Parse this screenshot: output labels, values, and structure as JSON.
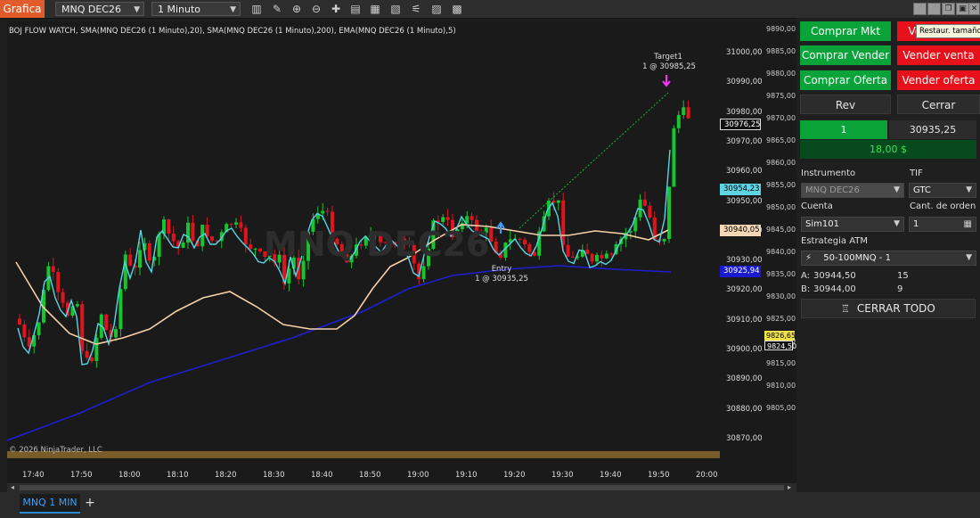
{
  "app_tab": "Grafica",
  "toolbar": {
    "instrument": "MNQ DEC26",
    "interval": "1 Minuto",
    "icons": [
      "bar-chart-icon",
      "pencil-icon",
      "zoom-in-icon",
      "zoom-out-icon",
      "crosshair-icon",
      "properties-icon",
      "indicators-icon",
      "strategies-icon",
      "alert-icon",
      "templates-icon"
    ]
  },
  "window_buttons": [
    "minimize-icon",
    "restore-icon",
    "maximize-icon",
    "close-icon"
  ],
  "tooltip": "Restaur. tamaño",
  "chart": {
    "indicators_label": "BOJ FLOW WATCH, SMA(MNQ DEC26 (1 Minuto),20), SMA(MNQ DEC26 (1 Minuto),200), EMA(MNQ DEC26 (1 Minuto),5)",
    "watermark": "MNQ DEC26",
    "copyright": "© 2026 NinjaTrader, LLC",
    "target_label": "Target1",
    "target_qty": "1 @ 30985,25",
    "entry_label": "Entry",
    "entry_qty": "1 @ 30935,25",
    "price_labels": [
      "31000,00",
      "30990,00",
      "30980,00",
      "30970,00",
      "30960,00",
      "30950,00",
      "30940,00",
      "30930,00",
      "30920,00",
      "30910,00",
      "30900,00",
      "30890,00",
      "30880,00",
      "30870,00"
    ],
    "price_labels2": [
      "9890,00",
      "9885,00",
      "9880,00",
      "9875,00",
      "9870,00",
      "9865,00",
      "9860,00",
      "9855,00",
      "9850,00",
      "9845,00",
      "9840,00",
      "9835,00",
      "9830,00",
      "9825,00",
      "9820,00",
      "9815,00",
      "9810,00",
      "9805,00"
    ],
    "price_boxes": {
      "last": "30976,25",
      "sma20": "30954,23",
      "ema": "30940,05",
      "sma200": "30925,94",
      "second1": "9826,65",
      "second2": "9824,50"
    },
    "time_labels": [
      "17:40",
      "17:50",
      "18:00",
      "18:10",
      "18:20",
      "18:30",
      "18:40",
      "18:50",
      "19:00",
      "19:10",
      "19:20",
      "19:30",
      "19:40",
      "19:50",
      "20:00"
    ]
  },
  "bottom_tab": "MNQ 1 MIN",
  "bottom_add": "+",
  "panel": {
    "buy_mkt": "Comprar Mkt",
    "sell_mkt": "Vender Mkt",
    "buy_bid": "Comprar Vender",
    "sell_ask": "Vender venta",
    "buy_offer": "Comprar Oferta",
    "sell_offer": "Vender oferta",
    "rev": "Rev",
    "close": "Cerrar",
    "position_qty": "1",
    "position_price": "30935,25",
    "pnl": "18,00 $",
    "instrument_label": "Instrumento",
    "instrument_value": "MNQ DEC26",
    "tif_label": "TIF",
    "tif_value": "GTC",
    "account_label": "Cuenta",
    "account_value": "Sim101",
    "qty_label": "Cant. de orden",
    "qty_value": "1",
    "atm_label": "Estrategia ATM",
    "atm_value": "50-100MNQ - 1",
    "ask_label": "A:",
    "ask_price": "30944,50",
    "ask_size": "15",
    "bid_label": "B:",
    "bid_price": "30944,00",
    "bid_size": "9",
    "close_all": "CERRAR TODO"
  }
}
